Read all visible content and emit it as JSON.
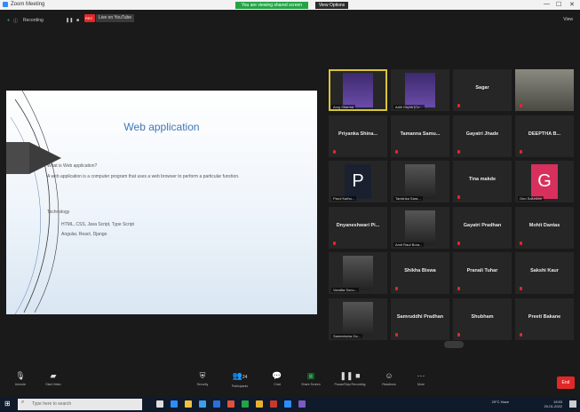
{
  "window": {
    "title": "Zoom Meeting"
  },
  "banner": {
    "share_text": "You are viewing shared screen",
    "view_options": "View Options"
  },
  "topbar": {
    "recording": "Recording",
    "rec_badge": "REC",
    "live": "Live on YouTube",
    "view": "View"
  },
  "slide": {
    "title": "Web application",
    "q1": "What is Web application?",
    "q2": "A web application is a computer program that uses a web browser to perform a particular function.",
    "q3": "Technology",
    "l1": "HTML, CSS, Java Script, Type Script",
    "l2": "Angular, React, Django"
  },
  "participants": [
    {
      "name": "",
      "label": "Anuj Sharma",
      "kind": "photo",
      "active": true
    },
    {
      "name": "",
      "label": "Aditi Gupta (Co...",
      "kind": "photo"
    },
    {
      "name": "Sagar",
      "label": "",
      "kind": "name"
    },
    {
      "name": "",
      "label": "",
      "kind": "video"
    },
    {
      "name": "Priyanka Shina...",
      "label": "",
      "kind": "name"
    },
    {
      "name": "Tamanna Samu...",
      "label": "",
      "kind": "name"
    },
    {
      "name": "Gayatri Jhade",
      "label": "",
      "kind": "name"
    },
    {
      "name": "DEEPTHA B...",
      "label": "",
      "kind": "name"
    },
    {
      "name": "",
      "label": "Parul Kathu...",
      "kind": "letter-p"
    },
    {
      "name": "",
      "label": "Tanishka Sara...",
      "kind": "photo"
    },
    {
      "name": "Tina makde",
      "label": "",
      "kind": "name"
    },
    {
      "name": "",
      "label": "Geo Salunkhe",
      "kind": "letter-g"
    },
    {
      "name": "Dnyaneshwari Pi...",
      "label": "",
      "kind": "name"
    },
    {
      "name": "",
      "label": "Amit Raut Bora...",
      "kind": "photo"
    },
    {
      "name": "Gayatri Pradhan",
      "label": "",
      "kind": "name"
    },
    {
      "name": "Mohit Dantas",
      "label": "",
      "kind": "name"
    },
    {
      "name": "",
      "label": "Vandita Sonu...",
      "kind": "photo"
    },
    {
      "name": "Shikha Biswa",
      "label": "",
      "kind": "name"
    },
    {
      "name": "Pranali Tuhar",
      "label": "",
      "kind": "name"
    },
    {
      "name": "Sakshi Kaur",
      "label": "",
      "kind": "name"
    },
    {
      "name": "",
      "label": "Sameeksha Ga...",
      "kind": "photo"
    },
    {
      "name": "Samruddhi Pradhan",
      "label": "",
      "kind": "name"
    },
    {
      "name": "Shubham",
      "label": "",
      "kind": "name"
    },
    {
      "name": "Preeti Bakane",
      "label": "",
      "kind": "name"
    }
  ],
  "toolbar": {
    "unmute": "Unmute",
    "start_video": "Start Video",
    "security": "Security",
    "participants": "Participants",
    "participants_count": "24",
    "chat": "Chat",
    "share": "Share Screen",
    "pause_share": "Pause/Stop Recording",
    "reactions": "Reactions",
    "more": "More",
    "end": "End"
  },
  "taskbar": {
    "search": "Type here to search",
    "tray": "29°C Haze",
    "time": "19:53",
    "date": "20-01-2022"
  },
  "colors": {
    "accent": "#2d8cff",
    "end": "#e02828",
    "share_green": "#23a446",
    "active_speaker": "#d7c53a"
  }
}
